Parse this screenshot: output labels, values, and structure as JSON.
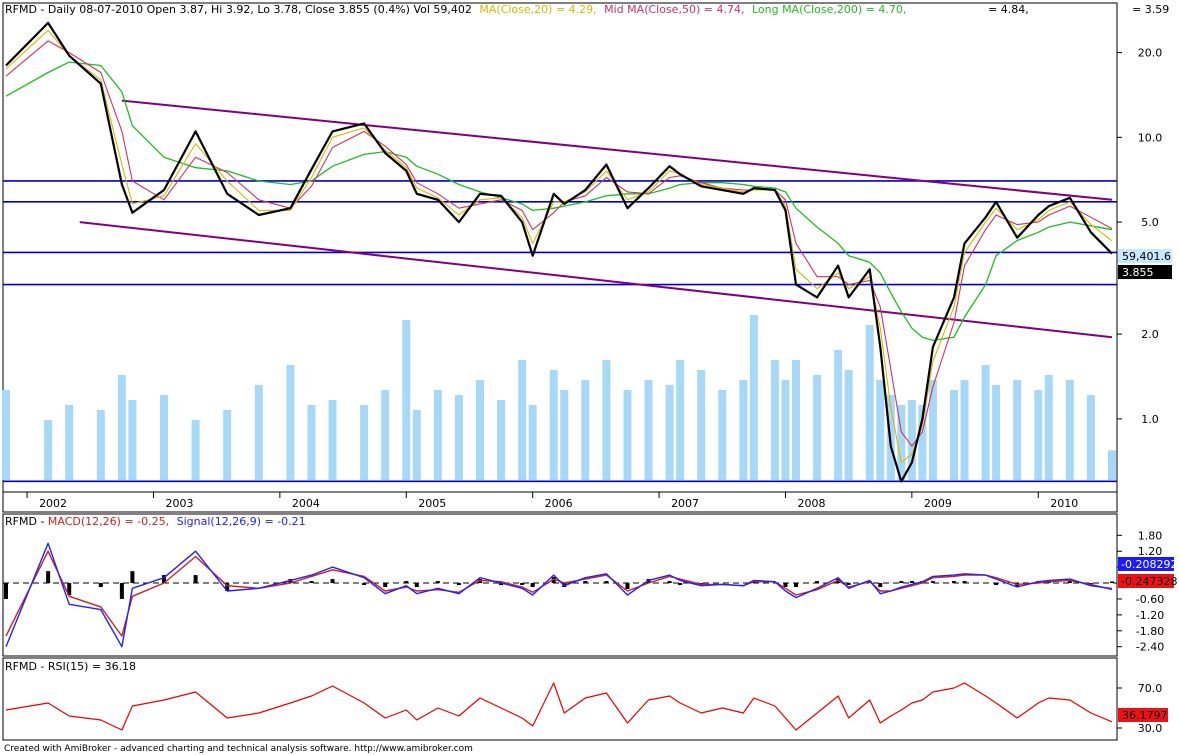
{
  "header": {
    "title_prefix": "RFMD - Daily 08-07-2010 Open 3.87, Hi 3.92, Lo 3.78, Close 3.855 (0.4%) Vol 59,402",
    "ma20": "MA(Close,20) = 4.29,",
    "ma50": "Mid MA(Close,50) = 4.74,",
    "ma200": "Long MA(Close,200) = 4.70,",
    "extra": "= 4.84,",
    "top_right": "= 3.59"
  },
  "macd_header": {
    "prefix": "RFMD - ",
    "macd": "MACD(12,26) = -0.25,",
    "signal": "Signal(12,26,9) = -0.21"
  },
  "rsi_header": {
    "prefix": "RFMD - ",
    "rsi": "RSI(15) = 36.18"
  },
  "footer": "Created with AmiBroker - advanced charting and technical analysis software. http://www.amibroker.com",
  "price_axis": {
    "ticks": [
      "20.0",
      "10.0",
      "5.0",
      "2.0",
      "1.0"
    ],
    "tick_values": [
      20,
      10,
      5,
      2,
      1
    ],
    "volume_tag": "59,401.6",
    "close_tag": "3.855"
  },
  "macd_axis": {
    "ticks": [
      "1.80",
      "1.20",
      "0.60",
      "-0.60",
      "-1.20",
      "-1.80",
      "-2.40"
    ],
    "tick_values": [
      1.8,
      1.2,
      0.6,
      -0.6,
      -1.2,
      -1.8,
      -2.4
    ],
    "macd_tag": "-0.208292",
    "signal_tag": "-0.247328"
  },
  "rsi_axis": {
    "ticks": [
      "70.0",
      "30.0"
    ],
    "tick_values": [
      70,
      30
    ],
    "rsi_tag": "36.1797"
  },
  "colors": {
    "price_bars": "#000000",
    "ma20": "#d8b800",
    "ma50": "#cc3366",
    "ma200": "#22bb22",
    "volume": "#a8d8f8",
    "support_lines": "#0000cc",
    "channel_lines": "#800080",
    "macd": "#2222ff",
    "signal": "#cc2222",
    "rsi": "#ee0000"
  },
  "chart_data": [
    {
      "type": "line",
      "panel": "price (log scale) with volume",
      "x_axis_labels": [
        "2002",
        "2003",
        "2004",
        "2005",
        "2006",
        "2007",
        "2008",
        "2009",
        "2010"
      ],
      "x_dates": [
        "2001-11",
        "2002-03",
        "2002-05",
        "2002-08",
        "2002-10",
        "2002-11",
        "2003-02",
        "2003-05",
        "2003-08",
        "2003-11",
        "2004-02",
        "2004-04",
        "2004-06",
        "2004-09",
        "2004-11",
        "2005-01",
        "2005-02",
        "2005-04",
        "2005-06",
        "2005-08",
        "2005-10",
        "2005-12",
        "2006-01",
        "2006-03",
        "2006-04",
        "2006-06",
        "2006-08",
        "2006-10",
        "2006-12",
        "2007-02",
        "2007-03",
        "2007-05",
        "2007-07",
        "2007-09",
        "2007-10",
        "2007-12",
        "2008-01",
        "2008-02",
        "2008-04",
        "2008-06",
        "2008-07",
        "2008-09",
        "2008-10",
        "2008-11",
        "2008-12",
        "2009-01",
        "2009-02",
        "2009-03",
        "2009-05",
        "2009-06",
        "2009-08",
        "2009-09",
        "2009-11",
        "2010-01",
        "2010-02",
        "2010-04",
        "2010-06",
        "2010-08"
      ],
      "series": [
        {
          "name": "Close",
          "values": [
            18.0,
            25.5,
            19.5,
            15.5,
            6.8,
            5.4,
            6.5,
            10.5,
            6.3,
            5.3,
            5.6,
            7.7,
            10.5,
            11.2,
            8.8,
            7.6,
            6.3,
            6.0,
            5.0,
            6.3,
            6.2,
            5.0,
            3.8,
            6.3,
            5.8,
            6.5,
            8.0,
            5.6,
            6.6,
            7.9,
            7.4,
            6.7,
            6.5,
            6.3,
            6.6,
            6.5,
            5.5,
            3.0,
            2.7,
            3.5,
            2.7,
            3.4,
            1.8,
            0.8,
            0.6,
            0.7,
            1.0,
            1.8,
            2.7,
            4.2,
            5.2,
            5.9,
            4.4,
            5.3,
            5.7,
            6.1,
            4.6,
            3.86
          ]
        },
        {
          "name": "MA(Close,20)",
          "values": [
            17.5,
            24.0,
            19.5,
            16.0,
            8.0,
            5.8,
            6.2,
            9.5,
            7.0,
            5.5,
            5.5,
            7.2,
            10.0,
            10.8,
            9.0,
            7.8,
            6.6,
            6.1,
            5.3,
            6.0,
            6.1,
            5.2,
            4.2,
            5.9,
            5.9,
            6.4,
            7.6,
            6.0,
            6.4,
            7.6,
            7.4,
            6.8,
            6.6,
            6.4,
            6.5,
            6.5,
            5.7,
            3.4,
            2.9,
            3.3,
            2.9,
            3.2,
            2.1,
            1.1,
            0.7,
            0.75,
            0.95,
            1.6,
            2.5,
            3.9,
            5.0,
            5.6,
            4.7,
            5.1,
            5.5,
            5.9,
            4.9,
            4.29
          ]
        },
        {
          "name": "Mid MA(Close,50)",
          "values": [
            16.5,
            22.0,
            20.0,
            17.0,
            10.5,
            7.0,
            6.0,
            8.5,
            7.5,
            6.0,
            5.6,
            6.7,
            9.2,
            10.5,
            9.3,
            8.0,
            6.9,
            6.3,
            5.6,
            5.8,
            6.0,
            5.5,
            4.7,
            5.4,
            5.9,
            6.2,
            7.2,
            6.4,
            6.3,
            7.2,
            7.3,
            6.9,
            6.6,
            6.5,
            6.5,
            6.5,
            6.0,
            4.2,
            3.2,
            3.2,
            3.0,
            3.1,
            2.5,
            1.5,
            0.9,
            0.8,
            0.9,
            1.3,
            2.2,
            3.5,
            4.7,
            5.3,
            4.9,
            5.0,
            5.3,
            5.7,
            5.2,
            4.74
          ]
        },
        {
          "name": "Long MA(Close,200)",
          "values": [
            14.0,
            17.0,
            18.5,
            18.0,
            14.5,
            11.0,
            8.5,
            7.8,
            7.6,
            7.0,
            6.8,
            7.0,
            7.9,
            8.7,
            8.9,
            8.5,
            7.9,
            7.4,
            6.8,
            6.4,
            6.1,
            5.8,
            5.5,
            5.6,
            5.7,
            5.9,
            6.2,
            6.3,
            6.3,
            6.6,
            6.8,
            6.9,
            6.9,
            6.8,
            6.7,
            6.6,
            6.4,
            5.6,
            4.8,
            4.2,
            3.8,
            3.6,
            3.3,
            2.8,
            2.4,
            2.1,
            1.95,
            1.9,
            1.95,
            2.3,
            3.0,
            3.8,
            4.3,
            4.6,
            4.8,
            5.0,
            4.85,
            4.7
          ]
        },
        {
          "name": "Vol",
          "values": [
            180000,
            120000,
            150000,
            140000,
            210000,
            160000,
            170000,
            120000,
            140000,
            190000,
            230000,
            150000,
            160000,
            150000,
            180000,
            320000,
            140000,
            180000,
            170000,
            200000,
            160000,
            240000,
            150000,
            220000,
            180000,
            200000,
            240000,
            180000,
            200000,
            190000,
            240000,
            220000,
            180000,
            200000,
            330000,
            240000,
            200000,
            240000,
            210000,
            260000,
            220000,
            310000,
            200000,
            170000,
            150000,
            160000,
            150000,
            200000,
            180000,
            200000,
            230000,
            190000,
            200000,
            180000,
            210000,
            200000,
            170000,
            59402
          ]
        }
      ],
      "horizontal_lines": [
        7.0,
        5.9,
        3.9,
        3.0,
        0.6
      ],
      "trend_channel": {
        "upper": {
          "from": [
            "2002-10",
            13.5
          ],
          "to": [
            "2010-08",
            6.0
          ]
        },
        "lower": {
          "from": [
            "2002-06",
            5.0
          ],
          "to": [
            "2010-08",
            1.95
          ]
        }
      }
    },
    {
      "type": "line",
      "panel": "MACD(12,26)",
      "x_dates": [
        "2001-11",
        "2002-03",
        "2002-05",
        "2002-08",
        "2002-10",
        "2002-11",
        "2003-02",
        "2003-05",
        "2003-08",
        "2003-11",
        "2004-02",
        "2004-04",
        "2004-06",
        "2004-09",
        "2004-11",
        "2005-01",
        "2005-02",
        "2005-04",
        "2005-06",
        "2005-08",
        "2005-10",
        "2005-12",
        "2006-01",
        "2006-03",
        "2006-04",
        "2006-06",
        "2006-08",
        "2006-10",
        "2006-12",
        "2007-02",
        "2007-03",
        "2007-05",
        "2007-07",
        "2007-09",
        "2007-10",
        "2007-12",
        "2008-01",
        "2008-02",
        "2008-04",
        "2008-06",
        "2008-07",
        "2008-09",
        "2008-10",
        "2008-11",
        "2008-12",
        "2009-01",
        "2009-02",
        "2009-03",
        "2009-05",
        "2009-06",
        "2009-08",
        "2009-09",
        "2009-11",
        "2010-01",
        "2010-02",
        "2010-04",
        "2010-06",
        "2010-08"
      ],
      "series": [
        {
          "name": "MACD(12,26)",
          "values": [
            -2.4,
            1.5,
            -0.8,
            -1.0,
            -2.4,
            -0.2,
            0.2,
            1.2,
            -0.3,
            -0.2,
            0.1,
            0.3,
            0.6,
            0.2,
            -0.4,
            -0.1,
            -0.4,
            -0.2,
            -0.4,
            0.2,
            0.0,
            -0.2,
            -0.45,
            0.3,
            -0.1,
            0.2,
            0.35,
            -0.45,
            0.1,
            0.3,
            0.1,
            -0.1,
            -0.05,
            -0.1,
            0.1,
            0.05,
            -0.3,
            -0.55,
            -0.2,
            0.2,
            -0.2,
            0.1,
            -0.4,
            -0.3,
            -0.15,
            -0.05,
            0.05,
            0.25,
            0.3,
            0.35,
            0.3,
            0.15,
            -0.15,
            0.05,
            0.1,
            0.15,
            -0.1,
            -0.208292
          ]
        },
        {
          "name": "Signal(12,26,9)",
          "values": [
            -2.0,
            1.2,
            -0.5,
            -0.9,
            -2.0,
            -0.5,
            0.0,
            1.0,
            -0.1,
            -0.2,
            0.0,
            0.25,
            0.5,
            0.25,
            -0.3,
            -0.15,
            -0.3,
            -0.25,
            -0.35,
            0.1,
            0.05,
            -0.15,
            -0.35,
            0.15,
            0.0,
            0.15,
            0.3,
            -0.3,
            0.0,
            0.25,
            0.15,
            -0.05,
            -0.05,
            -0.1,
            0.05,
            0.05,
            -0.2,
            -0.45,
            -0.25,
            0.1,
            -0.15,
            0.05,
            -0.3,
            -0.3,
            -0.2,
            -0.1,
            0.0,
            0.2,
            0.25,
            0.3,
            0.3,
            0.2,
            -0.05,
            0.0,
            0.05,
            0.1,
            -0.05,
            -0.247328
          ]
        }
      ],
      "ylim": [
        -2.6,
        2.0
      ]
    },
    {
      "type": "line",
      "panel": "RSI(15)",
      "x_dates": [
        "2001-11",
        "2002-03",
        "2002-05",
        "2002-08",
        "2002-10",
        "2002-11",
        "2003-02",
        "2003-05",
        "2003-08",
        "2003-11",
        "2004-02",
        "2004-04",
        "2004-06",
        "2004-09",
        "2004-11",
        "2005-01",
        "2005-02",
        "2005-04",
        "2005-06",
        "2005-08",
        "2005-10",
        "2005-12",
        "2006-01",
        "2006-03",
        "2006-04",
        "2006-06",
        "2006-08",
        "2006-10",
        "2006-12",
        "2007-02",
        "2007-03",
        "2007-05",
        "2007-07",
        "2007-09",
        "2007-10",
        "2007-12",
        "2008-01",
        "2008-02",
        "2008-04",
        "2008-06",
        "2008-07",
        "2008-09",
        "2008-10",
        "2008-11",
        "2008-12",
        "2009-01",
        "2009-02",
        "2009-03",
        "2009-05",
        "2009-06",
        "2009-08",
        "2009-09",
        "2009-11",
        "2010-01",
        "2010-02",
        "2010-04",
        "2010-06",
        "2010-08"
      ],
      "series": [
        {
          "name": "RSI(15)",
          "values": [
            48,
            55,
            42,
            38,
            28,
            52,
            58,
            66,
            40,
            45,
            55,
            62,
            72,
            55,
            40,
            48,
            38,
            50,
            42,
            60,
            50,
            40,
            32,
            75,
            45,
            60,
            65,
            35,
            58,
            62,
            55,
            45,
            50,
            45,
            60,
            52,
            40,
            28,
            45,
            62,
            40,
            58,
            35,
            42,
            48,
            55,
            58,
            66,
            70,
            75,
            62,
            55,
            40,
            55,
            60,
            58,
            45,
            36.18
          ]
        }
      ],
      "ylim": [
        20,
        90
      ]
    }
  ]
}
